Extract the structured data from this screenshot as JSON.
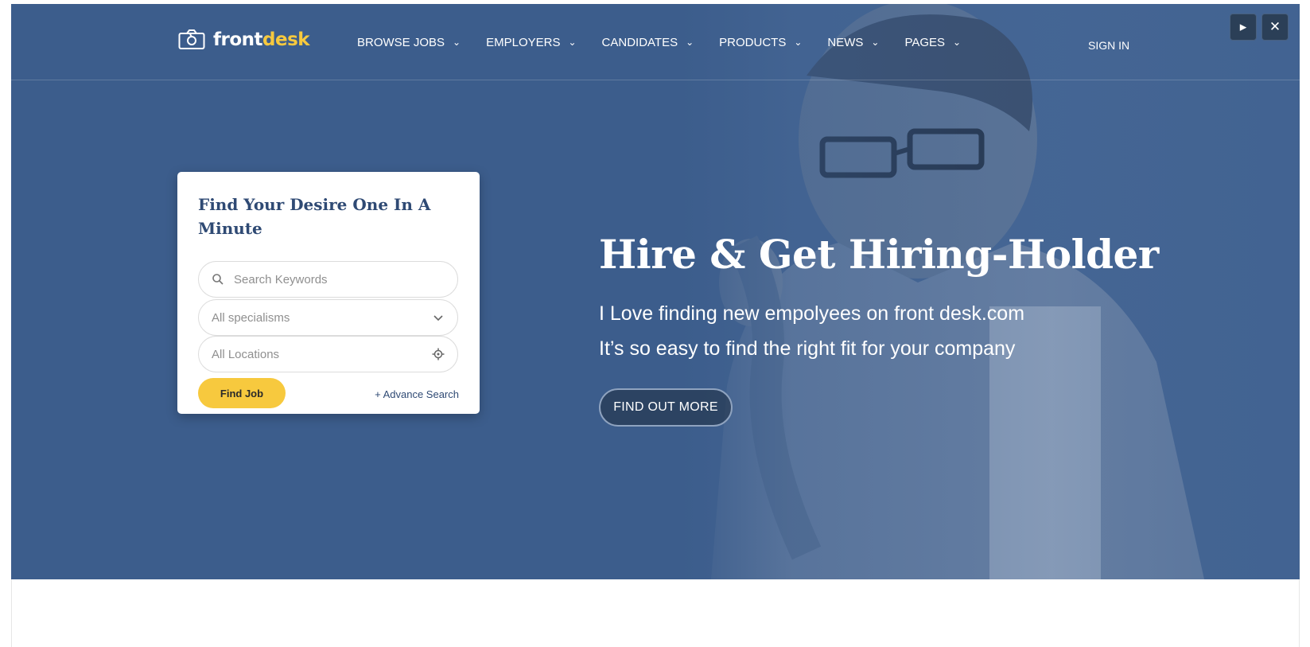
{
  "brand": {
    "part1": "front",
    "part2": "desk",
    "accent": "#f7c93e",
    "primary": "#3c5d8c"
  },
  "nav": {
    "items": [
      {
        "label": "BROWSE JOBS",
        "icon": "chevron-down-icon"
      },
      {
        "label": "EMPLOYERS",
        "icon": "chevron-down-icon"
      },
      {
        "label": "CANDIDATES",
        "icon": "chevron-down-icon"
      },
      {
        "label": "PRODUCTS",
        "icon": "chevron-down-icon"
      },
      {
        "label": "NEWS",
        "icon": "chevron-down-icon"
      },
      {
        "label": "PAGES",
        "icon": "chevron-down-icon"
      }
    ],
    "signin": "SIGN IN"
  },
  "controls": {
    "play_icon": "play-icon",
    "close_icon": "close-icon"
  },
  "search_card": {
    "title": "Find Your Desire One In A Minute",
    "keywords_placeholder": "Search Keywords",
    "specialisms_value": "All specialisms",
    "locations_value": "All Locations",
    "find_button": "Find Job",
    "advance_link": "+ Advance Search"
  },
  "hero": {
    "title": "Hire & Get Hiring-Holder",
    "line1": "I Love finding new empolyees on front desk.com",
    "line2": "It’s so easy to find the right fit for your company",
    "cta": "FIND OUT MORE"
  }
}
